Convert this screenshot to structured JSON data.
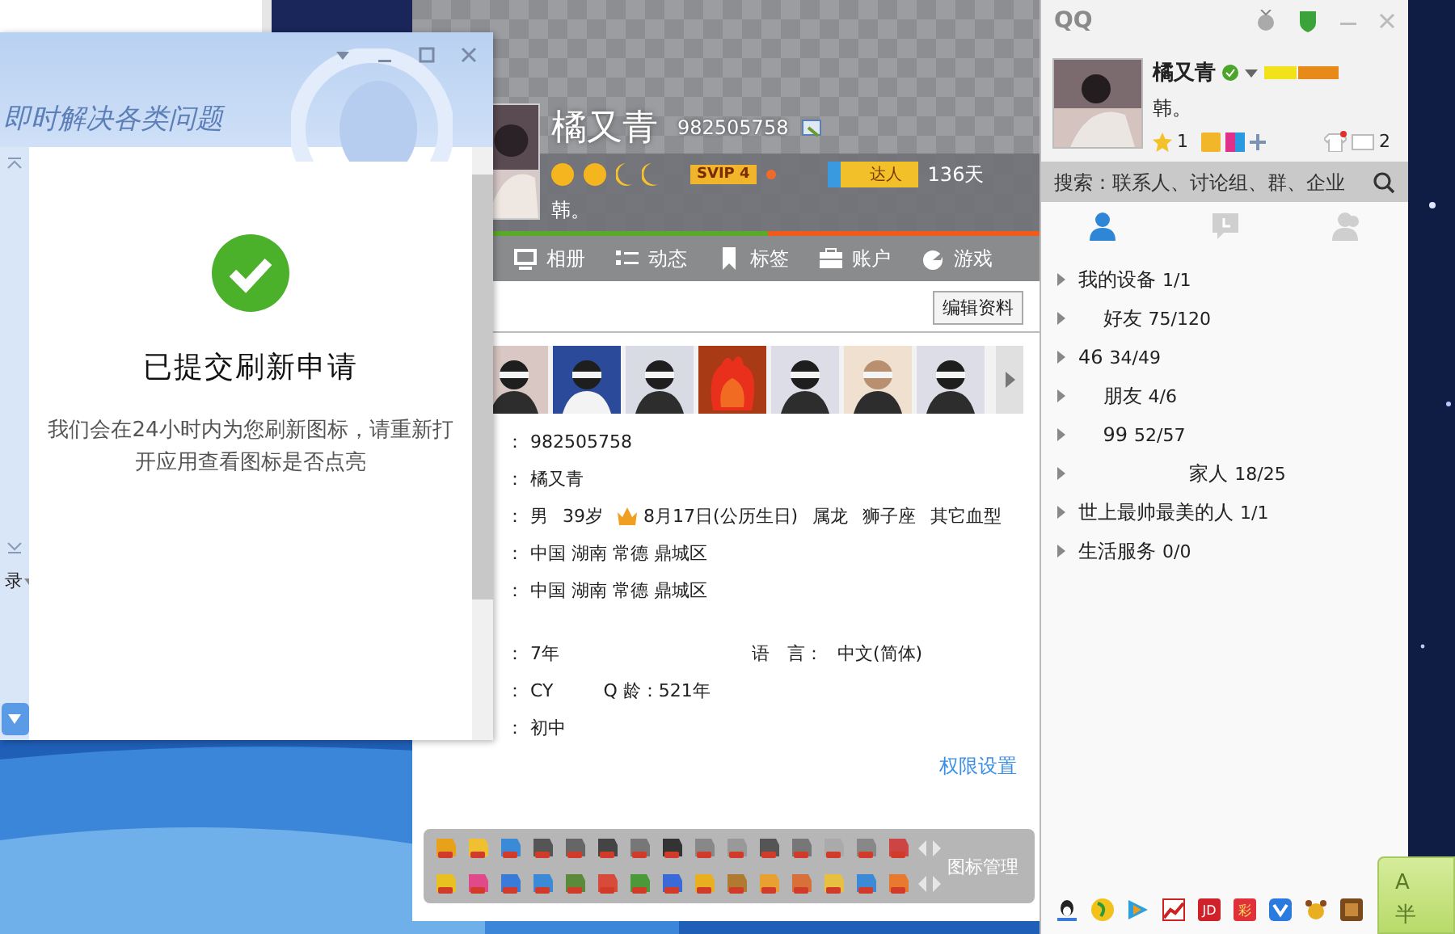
{
  "help_window": {
    "slogan": "即时解决各类问题",
    "side_label": "录",
    "dialog": {
      "title": "已提交刷新申请",
      "message": "我们会在24小时内为您刷新图标，请重新打开应用查看图标是否点亮"
    }
  },
  "profile_window": {
    "name": "橘又青",
    "qq_number": "982505758",
    "level_badge": "SVIP 4",
    "talent_badge": "达人",
    "active_days": "136天",
    "signature": "韩。",
    "tabs": [
      {
        "label": "相册"
      },
      {
        "label": "动态"
      },
      {
        "label": "标签"
      },
      {
        "label": "账户"
      },
      {
        "label": "游戏"
      }
    ],
    "edit_button": "编辑资料",
    "info_rows": [
      {
        "label": "：",
        "items": [
          {
            "text": "982505758",
            "kind": "plain"
          }
        ]
      },
      {
        "label": "：",
        "items": [
          {
            "text": "橘又青",
            "kind": "plain"
          }
        ]
      },
      {
        "label": "：",
        "items": [
          {
            "text": "男",
            "kind": "plain"
          },
          {
            "text": "39岁",
            "kind": "plain"
          },
          {
            "text": "8月17日(公历生日)",
            "kind": "birthday"
          },
          {
            "text": "属龙",
            "kind": "plain"
          },
          {
            "text": "狮子座",
            "kind": "plain"
          },
          {
            "text": "其它血型",
            "kind": "plain"
          }
        ]
      },
      {
        "label": "：",
        "items": [
          {
            "text": "中国 湖南 常德 鼎城区",
            "kind": "plain"
          }
        ]
      },
      {
        "label": "：",
        "items": [
          {
            "text": "中国 湖南 常德 鼎城区",
            "kind": "plain"
          }
        ]
      },
      {
        "label": "：",
        "items": [
          {
            "text": "7年",
            "kind": "plain"
          },
          {
            "text": "语　言：",
            "kind": "column"
          },
          {
            "text": "中文(简体)",
            "kind": "plain"
          }
        ]
      },
      {
        "label": "：",
        "items": [
          {
            "text": "CY",
            "kind": "plain"
          },
          {
            "text": "Q 龄：521年",
            "kind": "spaced"
          }
        ]
      },
      {
        "label": "：",
        "items": [
          {
            "text": "初中",
            "kind": "plain"
          }
        ]
      }
    ],
    "privacy_link": "权限设置",
    "icon_manager": "图标管理"
  },
  "main_panel": {
    "logo_text": "QQ",
    "name": "橘又青",
    "signature": "韩。",
    "star_count": "1",
    "mail_count": "2",
    "search_placeholder": "搜索：联系人、讨论组、群、企业",
    "tabs": [
      {
        "selected": true
      },
      {
        "selected": false
      },
      {
        "selected": false
      }
    ],
    "groups": [
      {
        "name": "我的设备",
        "count": "1/1"
      },
      {
        "name": "    好友",
        "count": "75/120"
      },
      {
        "name": "46",
        "count": "34/49"
      },
      {
        "name": "    朋友",
        "count": "4/6"
      },
      {
        "name": "    99",
        "count": "52/57"
      },
      {
        "name": "                  家人",
        "count": "18/25"
      },
      {
        "name": "世上最帅最美的人",
        "count": "1/1"
      },
      {
        "name": "生活服务",
        "count": "0/0"
      }
    ],
    "apps": [
      {
        "kind": "penguin"
      },
      {
        "kind": "music"
      },
      {
        "kind": "video"
      },
      {
        "kind": "stock"
      },
      {
        "kind": "jd",
        "label": "JD"
      },
      {
        "kind": "lottery",
        "label": "彩"
      },
      {
        "kind": "shield"
      },
      {
        "kind": "dog"
      },
      {
        "kind": "book"
      }
    ]
  },
  "ime": {
    "keys": [
      "A",
      "半"
    ]
  }
}
